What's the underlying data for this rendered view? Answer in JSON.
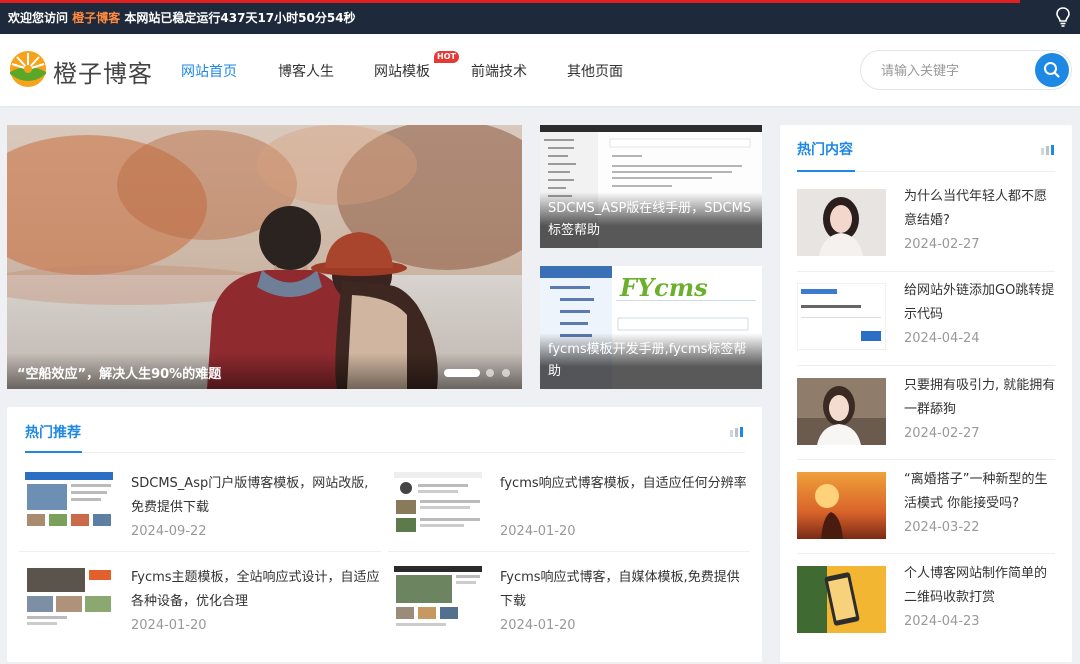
{
  "topbar": {
    "welcome": "欢迎您访问",
    "site_name": "橙子博客",
    "uptime": "本网站已稳定运行437天17小时50分54秒"
  },
  "header": {
    "logo_text": "橙子博客",
    "nav": [
      {
        "label": "网站首页",
        "active": true
      },
      {
        "label": "博客人生",
        "active": false
      },
      {
        "label": "网站模板",
        "active": false,
        "badge": "HOT"
      },
      {
        "label": "前端技术",
        "active": false
      },
      {
        "label": "其他页面",
        "active": false
      }
    ],
    "search": {
      "placeholder": "请输入关键字",
      "value": ""
    }
  },
  "carousel": {
    "main_caption": "“空船效应”，解决人生90%的难题",
    "side": [
      {
        "caption": "SDCMS_ASP版在线手册，SDCMS标签帮助"
      },
      {
        "caption": "fycms模板开发手册,fycms标签帮助"
      }
    ]
  },
  "recommend": {
    "title": "热门推荐",
    "items": [
      {
        "title": "SDCMS_Asp门户版博客模板，网站改版,免费提供下载",
        "date": "2024-09-22"
      },
      {
        "title": "fycms响应式博客模板，自适应任何分辨率",
        "date": "2024-01-20"
      },
      {
        "title": "Fycms主题模板，全站响应式设计，自适应各种设备，优化合理",
        "date": "2024-01-20"
      },
      {
        "title": "Fycms响应式博客，自媒体模板,免费提供下载",
        "date": "2024-01-20"
      }
    ]
  },
  "hot": {
    "title": "热门内容",
    "items": [
      {
        "title": "为什么当代年轻人都不愿意结婚?",
        "date": "2024-02-27"
      },
      {
        "title": "给网站外链添加GO跳转提示代码",
        "date": "2024-04-24"
      },
      {
        "title": "只要拥有吸引力, 就能拥有一群舔狗",
        "date": "2024-02-27"
      },
      {
        "title": "“离婚搭子”一种新型的生活模式 你能接受吗?",
        "date": "2024-03-22"
      },
      {
        "title": "个人博客网站制作简单的二维码收款打赏",
        "date": "2024-04-23"
      }
    ]
  },
  "colors": {
    "accent": "#1e88e5",
    "topbar_bg": "#1e2a3c",
    "highlight": "#ff8a3d"
  }
}
